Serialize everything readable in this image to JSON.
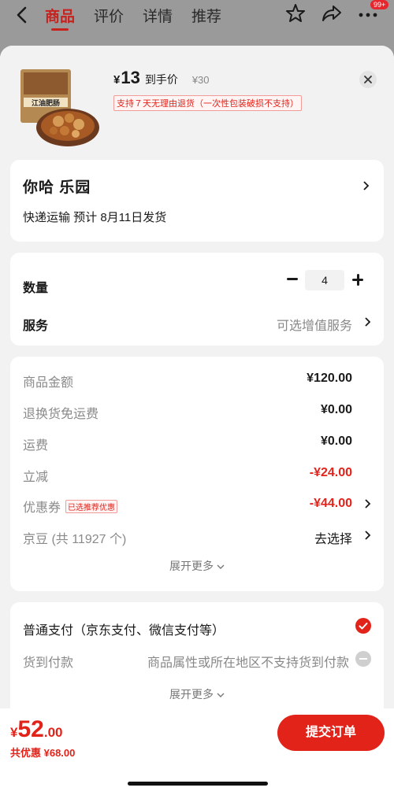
{
  "topbar": {
    "tabs": [
      "商品",
      "评价",
      "详情",
      "推荐"
    ],
    "badge": "99+"
  },
  "product": {
    "thumb_text": "江油肥肠",
    "yen": "¥",
    "price": "13",
    "price_label": "到手价",
    "original_price": "¥30",
    "return_policy": "支持７天无理由退货（一次性包装破损不支持）"
  },
  "address": {
    "name": "你哈  乐园",
    "shipping": "快递运输 预计 8月11日发货"
  },
  "options": {
    "quantity_label": "数量",
    "quantity_value": "4",
    "service_label": "服务",
    "service_value": "可选增值服务"
  },
  "summary": {
    "goods_amount_label": "商品金额",
    "goods_amount": "¥120.00",
    "return_shipping_label": "退换货免运费",
    "return_shipping": "¥0.00",
    "freight_label": "运费",
    "freight": "¥0.00",
    "discount_label": "立减",
    "discount": "-¥24.00",
    "coupon_label": "优惠券",
    "coupon_tag": "已选推荐优惠",
    "coupon": "-¥44.00",
    "jingdou_label": "京豆 (共 11927 个)",
    "jingdou_value": "去选择",
    "expand": "展开更多"
  },
  "payment": {
    "normal_label": "普通支付（京东支付、微信支付等）",
    "cod_label": "货到付款",
    "cod_note": "商品属性或所在地区不支持货到付款",
    "expand": "展开更多"
  },
  "bottom": {
    "yen": "¥",
    "total_int": "52",
    "total_dec": ".00",
    "saved": "共优惠 ¥68.00",
    "submit": "提交订单"
  },
  "colors": {
    "accent": "#e2231a"
  }
}
